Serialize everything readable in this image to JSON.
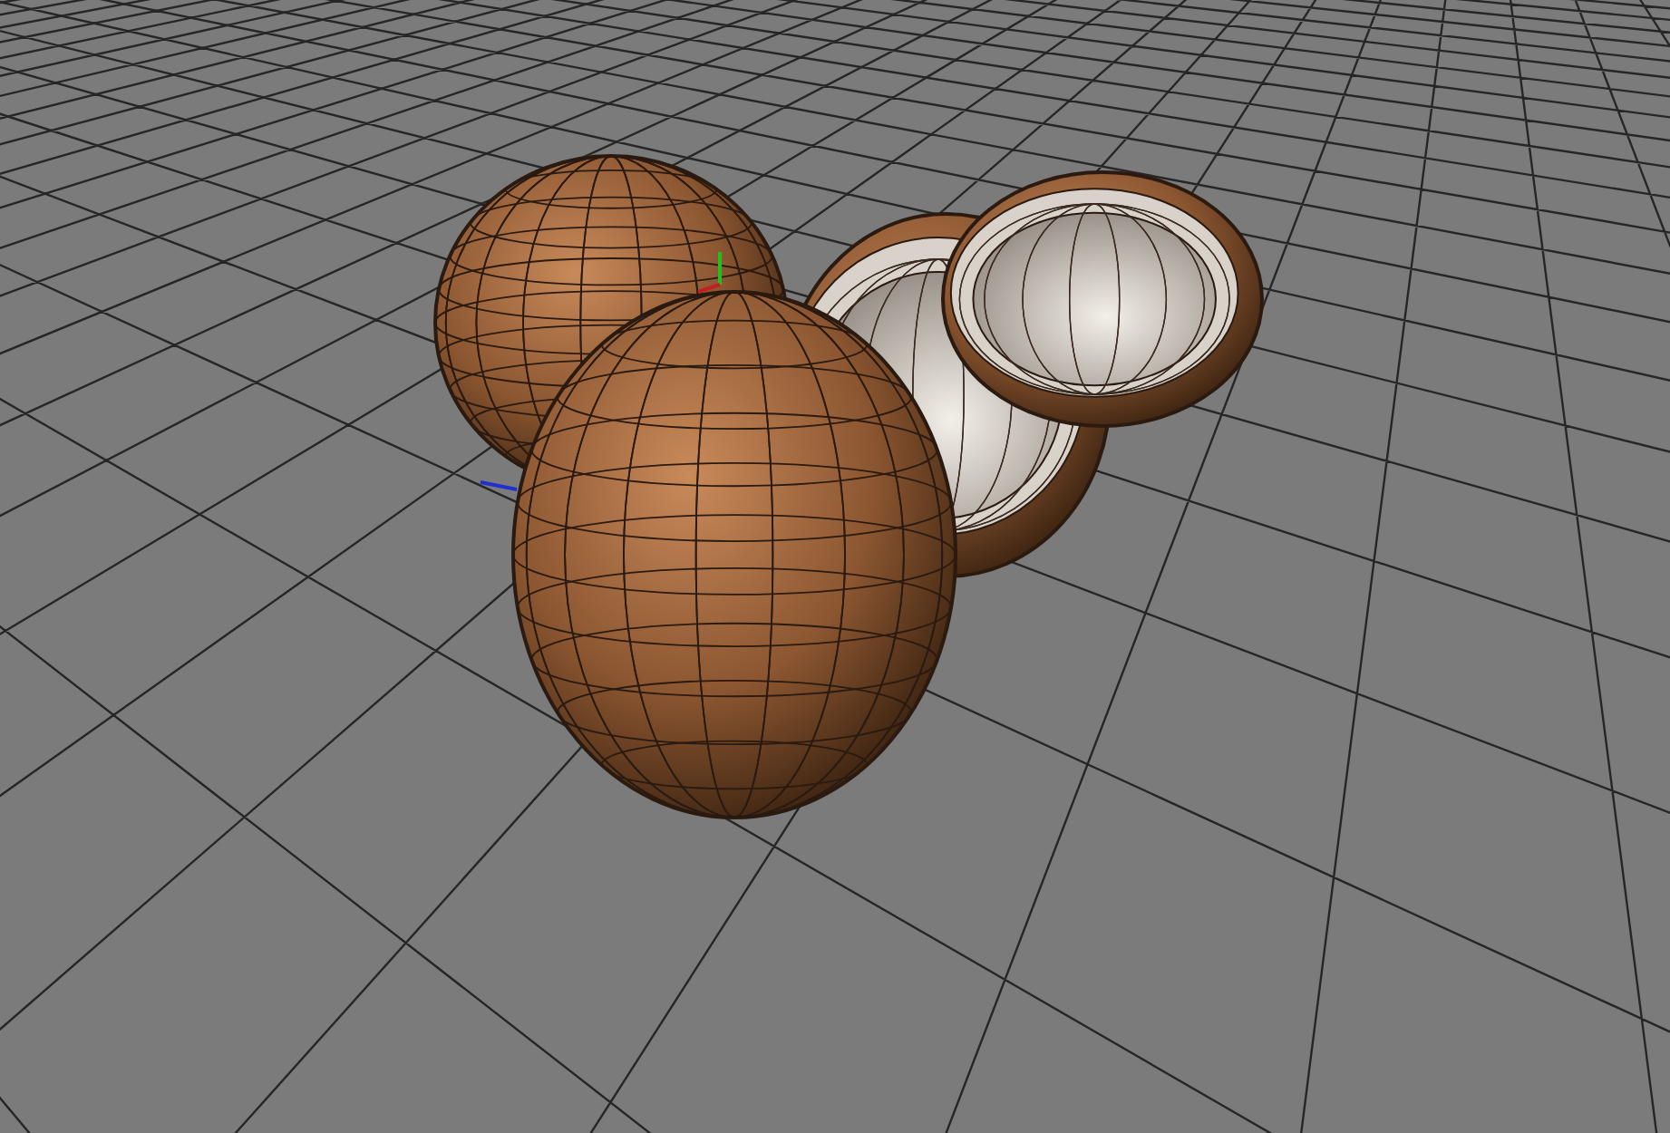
{
  "viewport": {
    "objects": [
      {
        "kind": "whole",
        "selected": false
      },
      {
        "kind": "half",
        "selected": false
      },
      {
        "kind": "half",
        "selected": false
      },
      {
        "kind": "whole",
        "selected": true
      }
    ]
  }
}
